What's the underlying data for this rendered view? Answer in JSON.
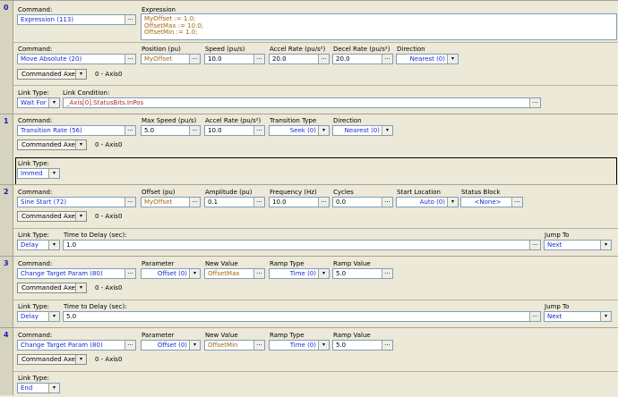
{
  "common": {
    "dots": "...",
    "arrow": "▾",
    "axis": "0 - Axis0",
    "cmd_axes": "Commanded Axes"
  },
  "labels": {
    "command": "Command:",
    "expression": "Expression",
    "position": "Position (pu)",
    "speed": "Speed (pu/s)",
    "accel": "Accel Rate (pu/s²)",
    "decel": "Decel Rate (pu/s²)",
    "direction": "Direction",
    "link_type": "Link Type:",
    "link_condition": "Link Condition:",
    "max_speed": "Max Speed (pu/s)",
    "transition_type": "Transition Type",
    "offset": "Offset (pu)",
    "amplitude": "Amplitude (pu)",
    "frequency": "Frequency (Hz)",
    "cycles": "Cycles",
    "start_location": "Start Location",
    "status_block": "Status Block",
    "time_to_delay": "Time to Delay (sec):",
    "jump_to": "Jump To",
    "parameter": "Parameter",
    "new_value": "New Value",
    "ramp_type": "Ramp Type",
    "ramp_value": "Ramp Value"
  },
  "steps": [
    {
      "num": "0",
      "expr_cmd": "Expression (113)",
      "expr_lines": [
        "MyOffset := 1.0;",
        "OffsetMax := 10.0;",
        "OffsetMin := 1.0;"
      ],
      "cmd": "Move Absolute (20)",
      "position": "MyOffset",
      "speed": "10.0",
      "accel": "20.0",
      "decel": "20.0",
      "direction": "Nearest (0)",
      "link_type": "Wait For",
      "link_condition": "_Axis[0].StatusBits.InPos"
    },
    {
      "num": "1",
      "cmd": "Transition Rate (56)",
      "max_speed": "5.0",
      "accel": "10.0",
      "transition_type": "Seek (0)",
      "direction": "Nearest (0)",
      "link_type": "Immed"
    },
    {
      "num": "2",
      "cmd": "Sine Start (72)",
      "offset": "MyOffset",
      "amplitude": "0.1",
      "frequency": "10.0",
      "cycles": "0.0",
      "start_location": "Auto (0)",
      "status_block": "<None>",
      "link_type": "Delay",
      "delay": "1.0",
      "jump_to": "Next"
    },
    {
      "num": "3",
      "cmd": "Change Target Param (80)",
      "parameter": "Offset (0)",
      "new_value": "OffsetMax",
      "ramp_type": "Time (0)",
      "ramp_value": "5.0",
      "link_type": "Delay",
      "delay": "5.0",
      "jump_to": "Next"
    },
    {
      "num": "4",
      "cmd": "Change Target Param (80)",
      "parameter": "Offset (0)",
      "new_value": "OffsetMin",
      "ramp_type": "Time (0)",
      "ramp_value": "5.0",
      "link_type": "End"
    }
  ]
}
